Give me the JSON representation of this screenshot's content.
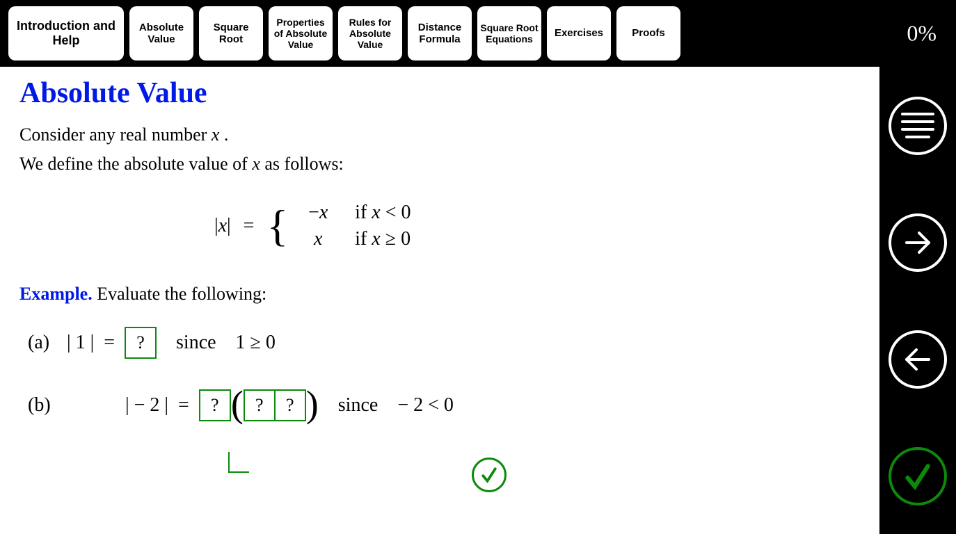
{
  "progress": "0%",
  "nav": {
    "items": [
      "Introduction and Help",
      "Absolute Value",
      "Square Root",
      "Properties of Absolute Value",
      "Rules for Absolute Value",
      "Distance Formula",
      "Square Root Equations",
      "Exercises",
      "Proofs"
    ]
  },
  "page": {
    "title": "Absolute Value",
    "intro_line1_prefix": "Consider any real number ",
    "intro_line1_var": "x",
    "intro_line1_suffix": " .",
    "intro_line2_prefix": "We define the absolute value of ",
    "intro_line2_var": "x",
    "intro_line2_suffix": " as follows:"
  },
  "definition": {
    "lhs": "|x|",
    "eq": "=",
    "case1_val": "−x",
    "case1_cond_prefix": "if ",
    "case1_cond": "x < 0",
    "case2_val": "x",
    "case2_cond_prefix": "if ",
    "case2_cond": "x ≥ 0"
  },
  "example": {
    "label": "Example.",
    "prompt": " Evaluate the following:",
    "a": {
      "label": "(a)",
      "expr": "| 1 |",
      "eq": "=",
      "box": "?",
      "since": "since",
      "cond": "1 ≥ 0"
    },
    "b": {
      "label": "(b)",
      "expr": "| − 2 |",
      "eq": "=",
      "box1": "?",
      "box2": "?",
      "box3": "?",
      "since": "since",
      "cond": "− 2 < 0"
    }
  }
}
